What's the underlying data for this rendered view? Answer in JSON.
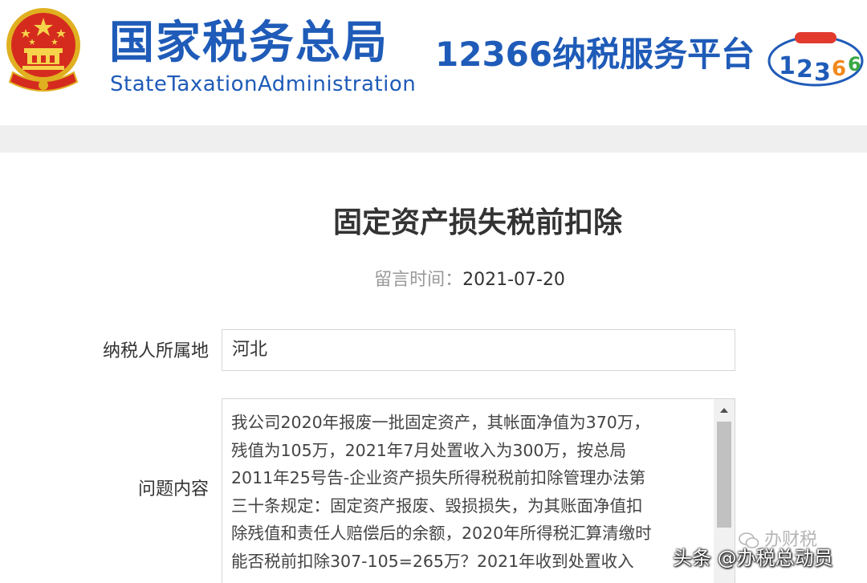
{
  "header": {
    "brand_cn": "国家税务总局",
    "brand_en": "StateTaxationAdministration",
    "platform": "12366纳税服务平台",
    "brand_color": "#1f5bb8"
  },
  "page": {
    "title": "固定资产损失税前扣除",
    "time_label": "留言时间：",
    "time_value": "2021-07-20"
  },
  "form": {
    "area_label": "纳税人所属地",
    "area_value": "河北",
    "content_label": "问题内容",
    "content_lines": [
      "我公司2020年报废一批固定资产，其帐面净值为370万，",
      "残值为105万，2021年7月处置收入为300万，按总局",
      "2011年25号告-企业资产损失所得税税前扣除管理办法第",
      "三十条规定：固定资产报废、毁损损失，为其账面净值扣",
      "除残值和责任人赔偿后的余额，2020年所得税汇算清缴时",
      "能否税前扣除307-105=265万？2021年收到处置收入"
    ]
  },
  "watermark": {
    "text": "头条 @办税总动员",
    "ghost": "办财税"
  }
}
